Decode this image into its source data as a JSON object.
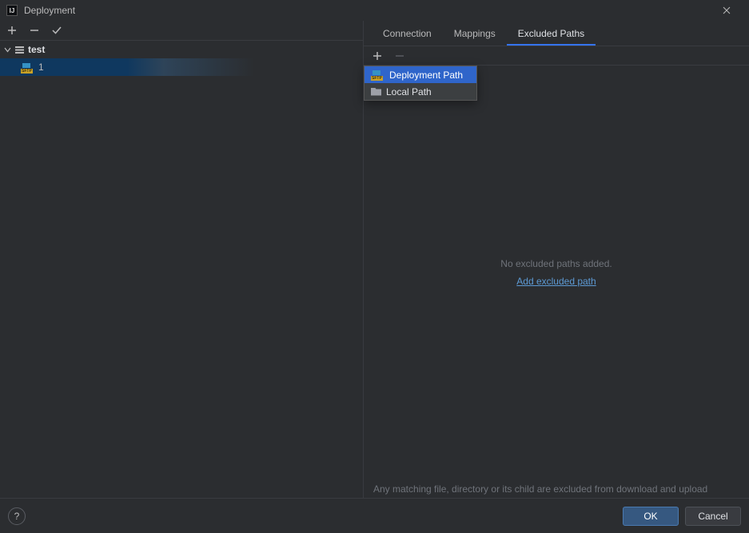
{
  "window": {
    "title": "Deployment"
  },
  "left": {
    "toolbar": {
      "add": "+",
      "remove": "−",
      "apply": "✓"
    },
    "tree": {
      "group_label": "test",
      "items": [
        {
          "label": "1"
        }
      ]
    }
  },
  "tabs": {
    "connection": "Connection",
    "mappings": "Mappings",
    "excluded": "Excluded Paths",
    "active": "excluded"
  },
  "right_toolbar": {
    "add": "+",
    "remove": "−"
  },
  "popup": {
    "deployment_path": "Deployment Path",
    "local_path": "Local Path"
  },
  "empty_state": {
    "message": "No excluded paths added.",
    "action": "Add excluded path"
  },
  "hint": "Any matching file, directory or its child are excluded from download and upload",
  "footer": {
    "ok": "OK",
    "cancel": "Cancel",
    "help": "?"
  }
}
